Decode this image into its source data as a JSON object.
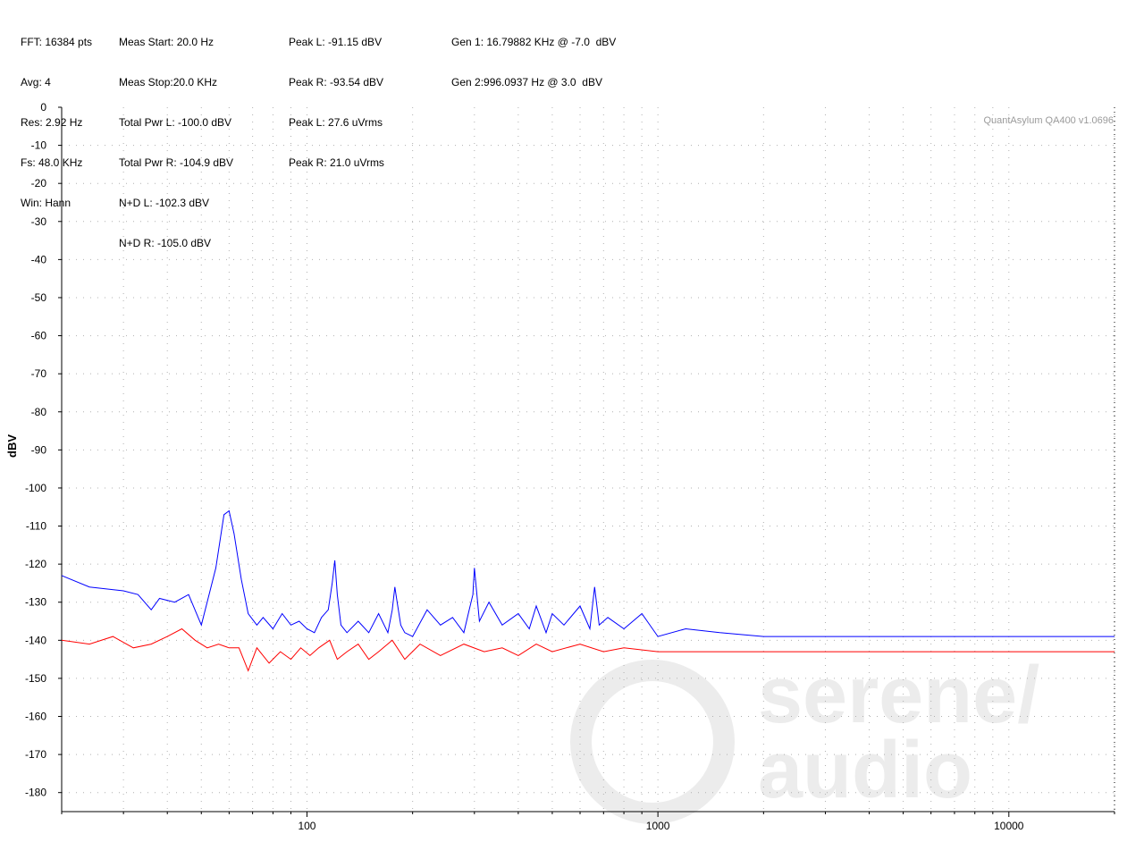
{
  "header": {
    "col1": [
      "FFT: 16384 pts",
      "Avg: 4",
      "Res: 2.92 Hz",
      "Fs: 48.0 KHz",
      "Win: Hann"
    ],
    "col2": [
      "Meas Start: 20.0 Hz",
      "Meas Stop:20.0 KHz",
      "Total Pwr L: -100.0 dBV",
      "Total Pwr R: -104.9 dBV",
      "N+D L: -102.3 dBV",
      "N+D R: -105.0 dBV"
    ],
    "col3": [
      "Peak L: -91.15 dBV",
      "Peak R: -93.54 dBV",
      "Peak L: 27.6 uVrms",
      "Peak R: 21.0 uVrms"
    ],
    "col4": [
      "Gen 1: 16.79882 KHz @ -7.0  dBV",
      "Gen 2:996.0937 Hz @ 3.0  dBV"
    ]
  },
  "watermark_text": "QuantAsylum QA400 v1.0696",
  "logo_text": [
    "serene/",
    "audio"
  ],
  "chart_data": {
    "type": "line",
    "ylabel": "dBV",
    "xlabel": "",
    "x_scale": "log",
    "xlim": [
      20,
      20000
    ],
    "ylim": [
      -185,
      0
    ],
    "yticks": [
      0,
      -10,
      -20,
      -30,
      -40,
      -50,
      -60,
      -70,
      -80,
      -90,
      -100,
      -110,
      -120,
      -130,
      -140,
      -150,
      -160,
      -170,
      -180
    ],
    "xtick_labels": [
      100,
      1000,
      10000
    ],
    "grid": true,
    "colors": {
      "series_blue": "#0000ff",
      "series_red": "#ff0000",
      "grid": "#b0b0b0",
      "logo": "#ececec"
    },
    "series": [
      {
        "color": "#0000ff",
        "x": [
          20,
          24,
          30,
          33,
          36,
          38,
          42,
          46,
          50,
          55,
          58,
          60,
          62,
          65,
          68,
          72,
          75,
          80,
          85,
          90,
          95,
          100,
          105,
          110,
          115,
          118,
          120,
          122,
          125,
          130,
          140,
          150,
          160,
          170,
          175,
          178,
          180,
          185,
          190,
          200,
          220,
          240,
          260,
          280,
          290,
          297,
          300,
          310,
          330,
          360,
          400,
          430,
          450,
          480,
          500,
          540,
          600,
          640,
          660,
          680,
          720,
          800,
          900,
          1000,
          1200,
          1500,
          2000,
          3000,
          5000,
          8000,
          12000,
          16000,
          20000
        ],
        "y": [
          -123,
          -126,
          -127,
          -128,
          -132,
          -129,
          -130,
          -128,
          -136,
          -121,
          -107,
          -106,
          -112,
          -124,
          -133,
          -136,
          -134,
          -137,
          -133,
          -136,
          -135,
          -137,
          -138,
          -134,
          -132,
          -125,
          -119,
          -128,
          -136,
          -138,
          -135,
          -138,
          -133,
          -138,
          -132,
          -126,
          -129,
          -136,
          -138,
          -139,
          -132,
          -136,
          -134,
          -138,
          -132,
          -128,
          -121,
          -135,
          -130,
          -136,
          -133,
          -137,
          -131,
          -138,
          -133,
          -136,
          -131,
          -137,
          -126,
          -136,
          -134,
          -137,
          -133,
          -139,
          -137,
          -138,
          -139,
          -139,
          -139,
          -139,
          -139,
          -139,
          -139
        ]
      },
      {
        "color": "#ff0000",
        "x": [
          20,
          24,
          28,
          32,
          36,
          40,
          44,
          48,
          52,
          56,
          60,
          64,
          68,
          72,
          78,
          84,
          90,
          96,
          102,
          108,
          116,
          122,
          130,
          140,
          150,
          160,
          175,
          190,
          210,
          240,
          280,
          320,
          360,
          400,
          450,
          500,
          600,
          700,
          800,
          1000,
          1300,
          1700,
          2200,
          3000,
          4500,
          6500,
          9000,
          12000,
          16000,
          20000
        ],
        "y": [
          -140,
          -141,
          -139,
          -142,
          -141,
          -139,
          -137,
          -140,
          -142,
          -141,
          -142,
          -142,
          -148,
          -142,
          -146,
          -143,
          -145,
          -142,
          -144,
          -142,
          -140,
          -145,
          -143,
          -141,
          -145,
          -143,
          -140,
          -145,
          -141,
          -144,
          -141,
          -143,
          -142,
          -144,
          -141,
          -143,
          -141,
          -143,
          -142,
          -143,
          -143,
          -143,
          -143,
          -143,
          -143,
          -143,
          -143,
          -143,
          -143,
          -143
        ]
      }
    ]
  }
}
